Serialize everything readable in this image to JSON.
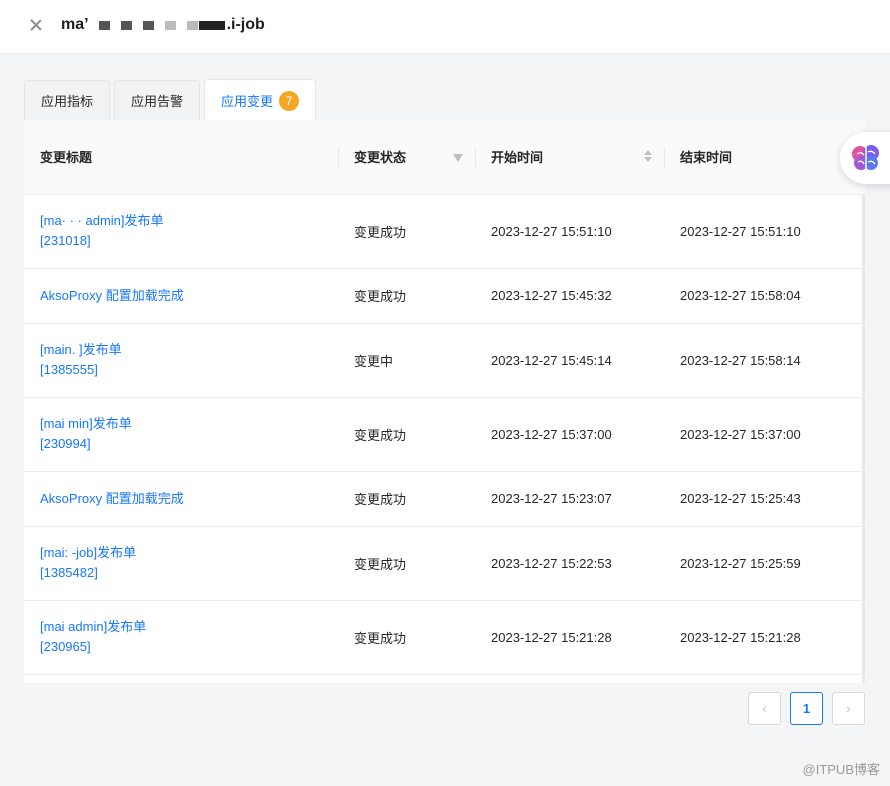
{
  "header": {
    "title_prefix": "ma’",
    "title_suffix": ".i-job"
  },
  "tabs": [
    {
      "label": "应用指标"
    },
    {
      "label": "应用告警"
    },
    {
      "label": "应用变更",
      "badge": "7"
    }
  ],
  "table": {
    "columns": [
      "变更标题",
      "变更状态",
      "开始时间",
      "结束时间"
    ],
    "rows": [
      {
        "title_line1": "[ma·             ·     ·     admin]发布单",
        "title_line2": "[231018]",
        "status": "变更成功",
        "start": "2023-12-27 15:51:10",
        "end": "2023-12-27 15:51:10"
      },
      {
        "title_line1": "AksoProxy 配置加载完成",
        "title_line2": "",
        "status": "变更成功",
        "start": "2023-12-27 15:45:32",
        "end": "2023-12-27 15:58:04"
      },
      {
        "title_line1": "[main.                      ]发布单",
        "title_line2": "[1385555]",
        "status": "变更中",
        "start": "2023-12-27 15:45:14",
        "end": "2023-12-27 15:58:14"
      },
      {
        "title_line1": "[mai               min]发布单",
        "title_line2": "[230994]",
        "status": "变更成功",
        "start": "2023-12-27 15:37:00",
        "end": "2023-12-27 15:37:00"
      },
      {
        "title_line1": "AksoProxy 配置加载完成",
        "title_line2": "",
        "status": "变更成功",
        "start": "2023-12-27 15:23:07",
        "end": "2023-12-27 15:25:43"
      },
      {
        "title_line1": "[mai:              -job]发布单",
        "title_line2": "[1385482]",
        "status": "变更成功",
        "start": "2023-12-27 15:22:53",
        "end": "2023-12-27 15:25:59"
      },
      {
        "title_line1": "[mai                   admin]发布单",
        "title_line2": "[230965]",
        "status": "变更成功",
        "start": "2023-12-27 15:21:28",
        "end": "2023-12-27 15:21:28"
      }
    ]
  },
  "pagination": {
    "prev": "‹",
    "current": "1",
    "next": "›"
  },
  "credit": "@ITPUB博客",
  "icons": {
    "close": "close-icon",
    "brain": "brain-icon",
    "filter": "filter-icon",
    "sort": "sort-icon"
  }
}
